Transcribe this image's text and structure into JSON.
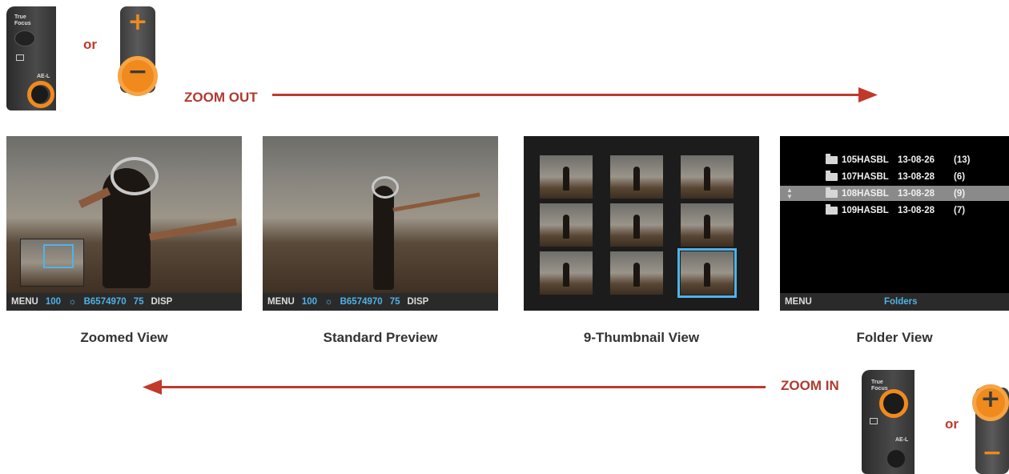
{
  "labels": {
    "or_top": "or",
    "or_bottom": "or",
    "zoom_out": "ZOOM OUT",
    "zoom_in": "ZOOM IN"
  },
  "controls": {
    "top_camera_labels": [
      "True Focus",
      "AE-L"
    ],
    "bottom_camera_labels": [
      "True Focus",
      "AE-L"
    ]
  },
  "views": [
    {
      "caption": "Zoomed View",
      "status": {
        "menu": "MENU",
        "iso": "100",
        "file": "B6574970",
        "quality": "75",
        "disp": "DISP"
      }
    },
    {
      "caption": "Standard Preview",
      "status": {
        "menu": "MENU",
        "iso": "100",
        "file": "B6574970",
        "quality": "75",
        "disp": "DISP"
      }
    },
    {
      "caption": "9-Thumbnail View"
    },
    {
      "caption": "Folder View",
      "folders": [
        {
          "name": "105HASBL",
          "date": "13-08-26",
          "count": "(13)"
        },
        {
          "name": "107HASBL",
          "date": "13-08-28",
          "count": "(6)"
        },
        {
          "name": "108HASBL",
          "date": "13-08-28",
          "count": "(9)"
        },
        {
          "name": "109HASBL",
          "date": "13-08-28",
          "count": "(7)"
        }
      ],
      "status": {
        "menu": "MENU",
        "mode": "Folders"
      }
    }
  ],
  "colors": {
    "accent_orange": "#f08a1c",
    "arrow_red": "#c0392b",
    "highlight_blue": "#4fb3e8"
  }
}
